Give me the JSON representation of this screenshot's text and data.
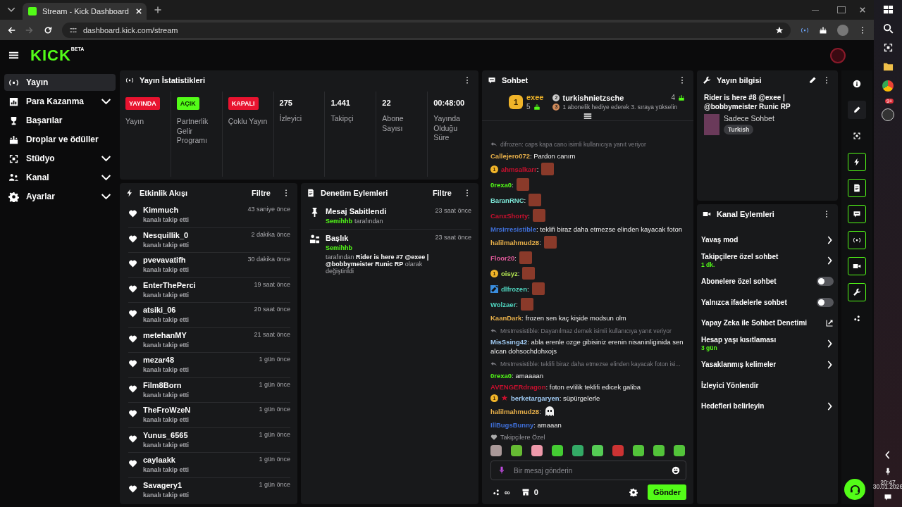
{
  "browser": {
    "tab_title": "Stream - Kick Dashboard",
    "url": "dashboard.kick.com/stream"
  },
  "header": {
    "logo": "KICK",
    "logo_badge": "BETA"
  },
  "sidebar": {
    "items": [
      {
        "label": "Yayın",
        "expandable": false,
        "selected": true
      },
      {
        "label": "Para Kazanma",
        "expandable": true,
        "selected": false
      },
      {
        "label": "Başarılar",
        "expandable": false,
        "selected": false
      },
      {
        "label": "Droplar ve ödüller",
        "expandable": false,
        "selected": false
      },
      {
        "label": "Stüdyo",
        "expandable": true,
        "selected": false
      },
      {
        "label": "Kanal",
        "expandable": true,
        "selected": false
      },
      {
        "label": "Ayarlar",
        "expandable": true,
        "selected": false
      }
    ]
  },
  "stats": {
    "title": "Yayın İstatistikleri",
    "items": [
      {
        "kind": "badge",
        "value": "YAYINDA",
        "color": "#e8132f",
        "caption": "Yayın"
      },
      {
        "kind": "badge",
        "value": "AÇIK",
        "color": "#53fc18",
        "caption": "Partnerlik Gelir Programı"
      },
      {
        "kind": "badge",
        "value": "KAPALI",
        "color": "#e8132f",
        "caption": "Çoklu Yayın"
      },
      {
        "kind": "number",
        "value": "275",
        "caption": "İzleyici"
      },
      {
        "kind": "number",
        "value": "1.441",
        "caption": "Takipçi"
      },
      {
        "kind": "number",
        "value": "22",
        "caption": "Abone Sayısı"
      },
      {
        "kind": "number",
        "value": "00:48:00",
        "caption": "Yayında Olduğu Süre"
      }
    ]
  },
  "activity": {
    "title": "Etkinlik Akışı",
    "filter": "Filtre",
    "items": [
      {
        "user": "Kimmuch",
        "action": "kanalı takip etti",
        "time": "43 saniye önce"
      },
      {
        "user": "Nesquillik_0",
        "action": "kanalı takip etti",
        "time": "2 dakika önce"
      },
      {
        "user": "pvevavatifh",
        "action": "kanalı takip etti",
        "time": "30 dakika önce"
      },
      {
        "user": "EnterThePerci",
        "action": "kanalı takip etti",
        "time": "19 saat önce"
      },
      {
        "user": "atsiki_06",
        "action": "kanalı takip etti",
        "time": "20 saat önce"
      },
      {
        "user": "metehanMY",
        "action": "kanalı takip etti",
        "time": "21 saat önce"
      },
      {
        "user": "mezar48",
        "action": "kanalı takip etti",
        "time": "1 gün önce"
      },
      {
        "user": "Film8Born",
        "action": "kanalı takip etti",
        "time": "1 gün önce"
      },
      {
        "user": "TheFroWzeN",
        "action": "kanalı takip etti",
        "time": "1 gün önce"
      },
      {
        "user": "Yunus_6565",
        "action": "kanalı takip etti",
        "time": "1 gün önce"
      },
      {
        "user": "caylaakk",
        "action": "kanalı takip etti",
        "time": "1 gün önce"
      },
      {
        "user": "Savagery1",
        "action": "kanalı takip etti",
        "time": "1 gün önce"
      }
    ]
  },
  "moderation": {
    "title": "Denetim Eylemleri",
    "filter": "Filtre",
    "items": [
      {
        "kind": "pin",
        "title": "Mesaj Sabitlendi",
        "time": "23 saat önce",
        "by": "Semihhb",
        "detail": "tarafından"
      },
      {
        "kind": "title",
        "title": "Başlık",
        "time": "23 saat önce",
        "by": "Semihhb",
        "detail": "tarafından **Rider is here #7 @exee | @bobbymeister Runic RP** olarak değiştirildi"
      }
    ]
  },
  "chat": {
    "title": "Sohbet",
    "leaderboard": {
      "first": {
        "rank": "1",
        "name": "exee",
        "count": "5"
      },
      "second": {
        "rank": "2",
        "name": "turkishnietzsche",
        "count": "4"
      },
      "next": {
        "rank": "3",
        "text": "1 abonelik hediye ederek 3. sıraya yükselin"
      }
    },
    "messages": [
      {
        "kind": "reply",
        "text": "difrozen: caps kapa cano isimli kullanıcıya yanıt veriyor"
      },
      {
        "kind": "text",
        "user": "Callejero072",
        "color": "#e8b04a",
        "text": ": Pardon canım"
      },
      {
        "kind": "emote",
        "user": "ahmsalkarr",
        "color": "#c8102e",
        "text": ":",
        "badges": [
          {
            "kind": "sub",
            "label": "1"
          }
        ]
      },
      {
        "kind": "emote",
        "user": "0rexa0",
        "color": "#53fc18",
        "text": ":"
      },
      {
        "kind": "emote",
        "user": "BaranRNC",
        "color": "#7ee8d8",
        "text": ":"
      },
      {
        "kind": "emote",
        "user": "CanxShorty",
        "color": "#c8102e",
        "text": ":"
      },
      {
        "kind": "text",
        "user": "MrsIrresistible",
        "color": "#3f6fd8",
        "text": ": teklifi biraz daha etmezse elinden kayacak foton"
      },
      {
        "kind": "emote",
        "user": "halilmahmud28",
        "color": "#e8b04a",
        "text": ":"
      },
      {
        "kind": "emote",
        "user": "Floor20",
        "color": "#e05a9a",
        "text": ":"
      },
      {
        "kind": "emote",
        "user": "oisyz",
        "color": "#b5e853",
        "text": ":",
        "badges": [
          {
            "kind": "sub",
            "label": "1"
          }
        ]
      },
      {
        "kind": "emote",
        "user": "dlfrozen",
        "color": "#4fd6c0",
        "text": ":",
        "badges": [
          {
            "kind": "mod"
          }
        ]
      },
      {
        "kind": "emote",
        "user": "Wolzaer",
        "color": "#4fd6c0",
        "text": ":"
      },
      {
        "kind": "text",
        "user": "KaanDark",
        "color": "#e8b04a",
        "text": ": frozen sen kaç kişide modsun olm"
      },
      {
        "kind": "reply",
        "text": "MrsIrresistible: Dayanılmaz demek isimli kullanıcıya yanıt veriyor"
      },
      {
        "kind": "text",
        "user": "MisSsing42",
        "color": "#9ec8f0",
        "text": ": abla erenle ozge gibisiniz erenin nisaninliginida sen alcan dohsochdohxojs"
      },
      {
        "kind": "reply",
        "text": "MrsIrresistible: teklifi biraz daha etmezse elinden kayacak foton isi..."
      },
      {
        "kind": "text",
        "user": "0rexa0",
        "color": "#53fc18",
        "text": ": amaaaan"
      },
      {
        "kind": "text",
        "user": "AVENGERdragon",
        "color": "#c8102e",
        "text": ": foton evlilik teklifi edicek galiba"
      },
      {
        "kind": "text",
        "user": "berketargaryen",
        "color": "#9ec8f0",
        "text": ": süpürgelerle",
        "badges": [
          {
            "kind": "sub",
            "label": "1"
          },
          {
            "kind": "star"
          }
        ]
      },
      {
        "kind": "ghost",
        "user": "halilmahmud28",
        "color": "#e8b04a",
        "text": ":"
      },
      {
        "kind": "text",
        "user": "IllBugsBunny",
        "color": "#3f6fd8",
        "text": ": amaaan"
      }
    ],
    "emote_section": "Takipçilere Özel",
    "placeholder": "Bir mesaj gönderin",
    "points": "∞",
    "store_count": "0",
    "send": "Gönder"
  },
  "stream_info": {
    "title": "Yayın bilgisi",
    "stream_title": "Rider is here #8 @exee | @bobbymeister Runic RP",
    "category": "Sadece Sohbet",
    "tag": "Turkish"
  },
  "channel_actions": {
    "title": "Kanal Eylemleri",
    "items": [
      {
        "kind": "arrow",
        "label": "Yavaş mod"
      },
      {
        "kind": "arrow",
        "label": "Takipçilere özel sohbet",
        "sub": "1 dk."
      },
      {
        "kind": "toggle",
        "label": "Abonelere özel sohbet",
        "on": false
      },
      {
        "kind": "toggle",
        "label": "Yalnızca ifadelerle sohbet",
        "on": false
      },
      {
        "kind": "external",
        "label": "Yapay Zeka ile Sohbet Denetimi"
      },
      {
        "kind": "arrow",
        "label": "Hesap yaşı kısıtlaması",
        "sub": "3 gün"
      },
      {
        "kind": "arrow",
        "label": "Yasaklanmış kelimeler"
      },
      {
        "kind": "plain",
        "label": "İzleyici Yönlendir"
      },
      {
        "kind": "arrow",
        "label": "Hedefleri belirleyin"
      }
    ]
  },
  "rail": [
    {
      "on": false
    },
    {
      "on": false
    },
    {
      "on": false
    },
    {
      "on": true
    },
    {
      "on": true
    },
    {
      "on": true
    },
    {
      "on": true
    },
    {
      "on": true
    },
    {
      "on": true
    },
    {
      "on": false
    }
  ],
  "taskbar": {
    "badge": "9+",
    "time": "20:47",
    "date": "30.01.2026"
  }
}
